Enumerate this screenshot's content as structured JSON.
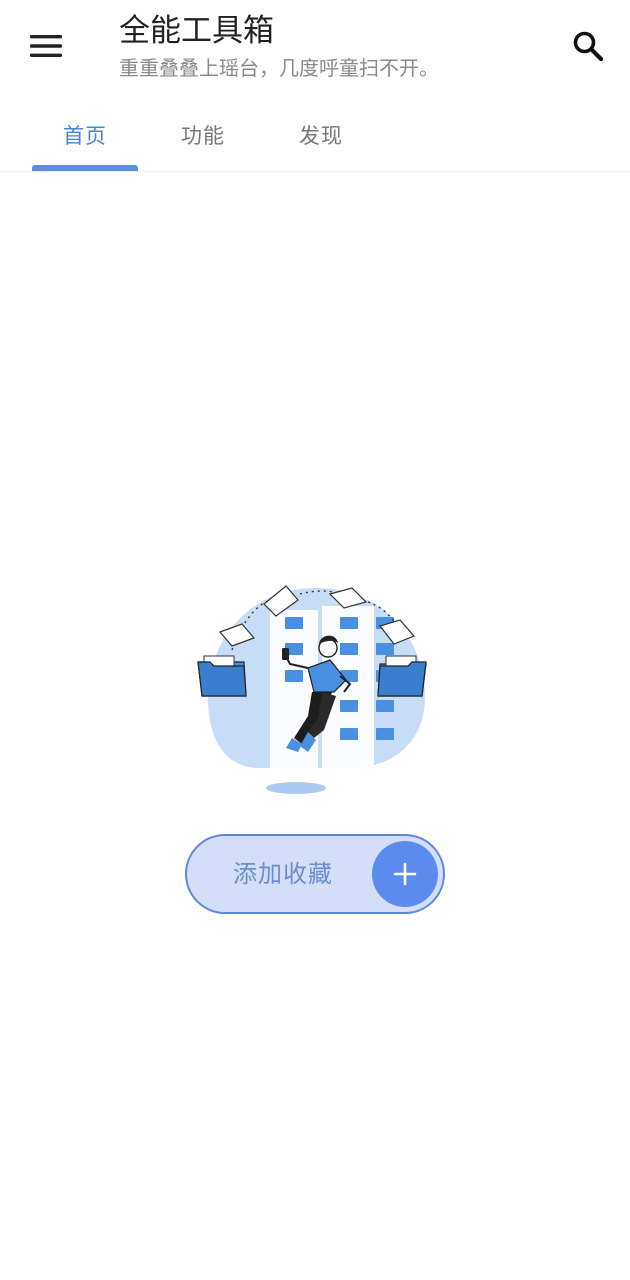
{
  "app": {
    "title": "全能工具箱",
    "subtitle": "重重叠叠上瑶台，几度呼童扫不开。"
  },
  "toolbar": {
    "menu_icon": "menu-icon",
    "search_icon": "search-icon"
  },
  "tabs": [
    {
      "label": "首页",
      "active": true
    },
    {
      "label": "功能",
      "active": false
    },
    {
      "label": "发现",
      "active": false
    }
  ],
  "empty_state": {
    "illustration": "person-juggling-folders-illustration",
    "button_label": "添加收藏",
    "button_icon": "plus-icon"
  },
  "colors": {
    "accent": "#5b8fe3",
    "tab_active_text": "#4a82d8",
    "button_fill": "#d4def9",
    "button_border": "#5d86de",
    "plus_circle": "#5b8ced",
    "illustration_bg": "#c6dcf7",
    "folder_blue": "#4a90e2"
  }
}
